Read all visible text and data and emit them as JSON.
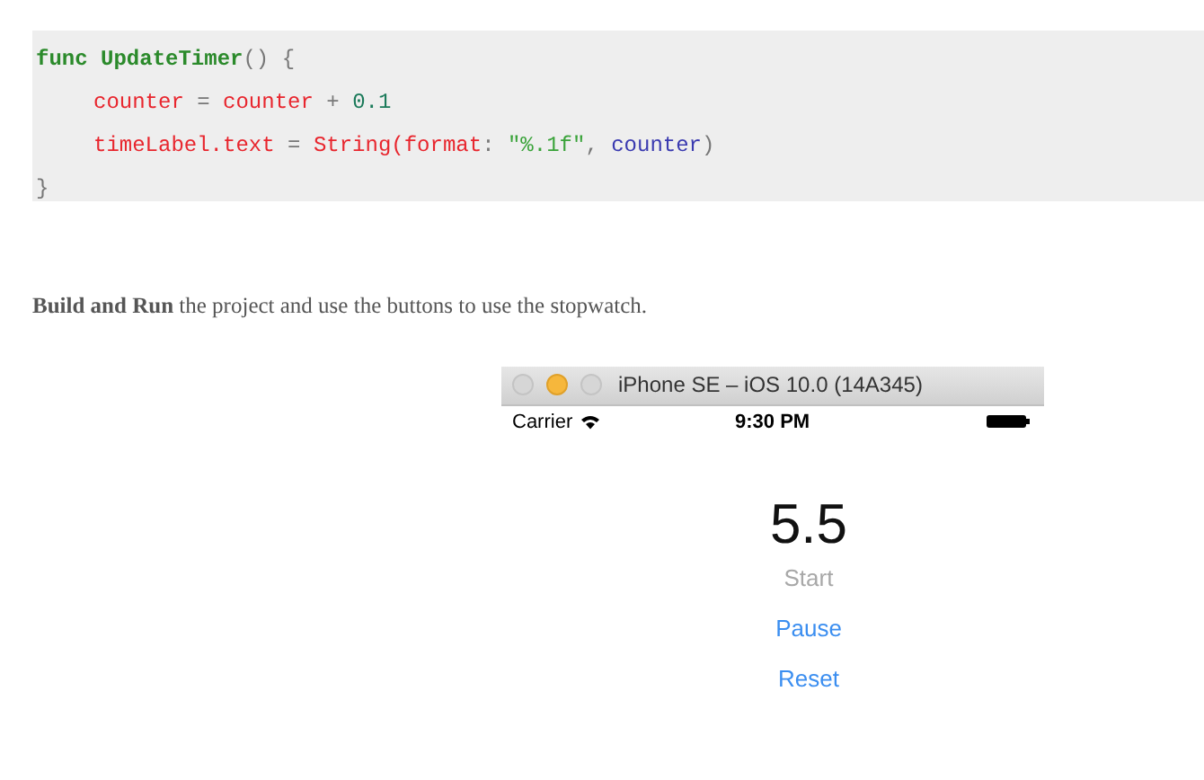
{
  "code_block": {
    "lines": [
      {
        "indented": false,
        "tokens": [
          {
            "kind": "keyword",
            "text": "func "
          },
          {
            "kind": "name",
            "text": "UpdateTimer"
          },
          {
            "kind": "punct",
            "text": "() {"
          }
        ]
      },
      {
        "indented": true,
        "tokens": [
          {
            "kind": "variable",
            "text": "counter"
          },
          {
            "kind": "punct",
            "text": " = "
          },
          {
            "kind": "variable",
            "text": "counter"
          },
          {
            "kind": "punct",
            "text": " + "
          },
          {
            "kind": "number",
            "text": "0.1"
          }
        ]
      },
      {
        "indented": true,
        "tokens": [
          {
            "kind": "variable",
            "text": "timeLabel.text"
          },
          {
            "kind": "punct",
            "text": " = "
          },
          {
            "kind": "variable",
            "text": "String(format"
          },
          {
            "kind": "punct",
            "text": ": "
          },
          {
            "kind": "string",
            "text": "\"%.1f\""
          },
          {
            "kind": "punct",
            "text": ", "
          },
          {
            "kind": "reference",
            "text": "counter"
          },
          {
            "kind": "punct",
            "text": ")"
          }
        ]
      },
      {
        "indented": false,
        "tokens": [
          {
            "kind": "punct",
            "text": "}"
          }
        ]
      }
    ]
  },
  "paragraph": "**Build and Run** the project and use the buttons to use the stopwatch.",
  "simulator": {
    "window_title": "iPhone SE – iOS 10.0 (14A345)",
    "status_bar": {
      "carrier": "Carrier",
      "time": "9:30 PM"
    },
    "timer_label": "5.5",
    "buttons": [
      {
        "label": "Start",
        "disabled": true
      },
      {
        "label": "Pause",
        "disabled": false
      },
      {
        "label": "Reset",
        "disabled": false
      }
    ]
  }
}
